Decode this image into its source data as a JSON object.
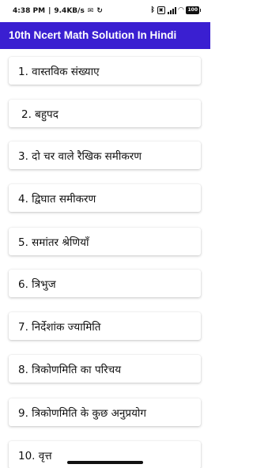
{
  "status_bar": {
    "time": "4:38 PM",
    "separator": "|",
    "speed": "9.4KB/s",
    "battery": "100"
  },
  "app_bar": {
    "title": "10th Ncert Math Solution In Hindi"
  },
  "chapters": [
    {
      "label": "1. वास्तविक संख्याए"
    },
    {
      "label": "2. बहुपद"
    },
    {
      "label": "3. दो चर वाले रैखिक समीकरण"
    },
    {
      "label": "4. द्विघात समीकरण"
    },
    {
      "label": "5. समांतर श्रेणियाँ"
    },
    {
      "label": "6. त्रिभुज"
    },
    {
      "label": "7. निर्देशांक ज्यामिति"
    },
    {
      "label": "8. त्रिकोणमिति का परिचय"
    },
    {
      "label": "9. त्रिकोणमिति के कुछ अनुप्रयोग"
    },
    {
      "label": "10. वृत्त"
    }
  ]
}
